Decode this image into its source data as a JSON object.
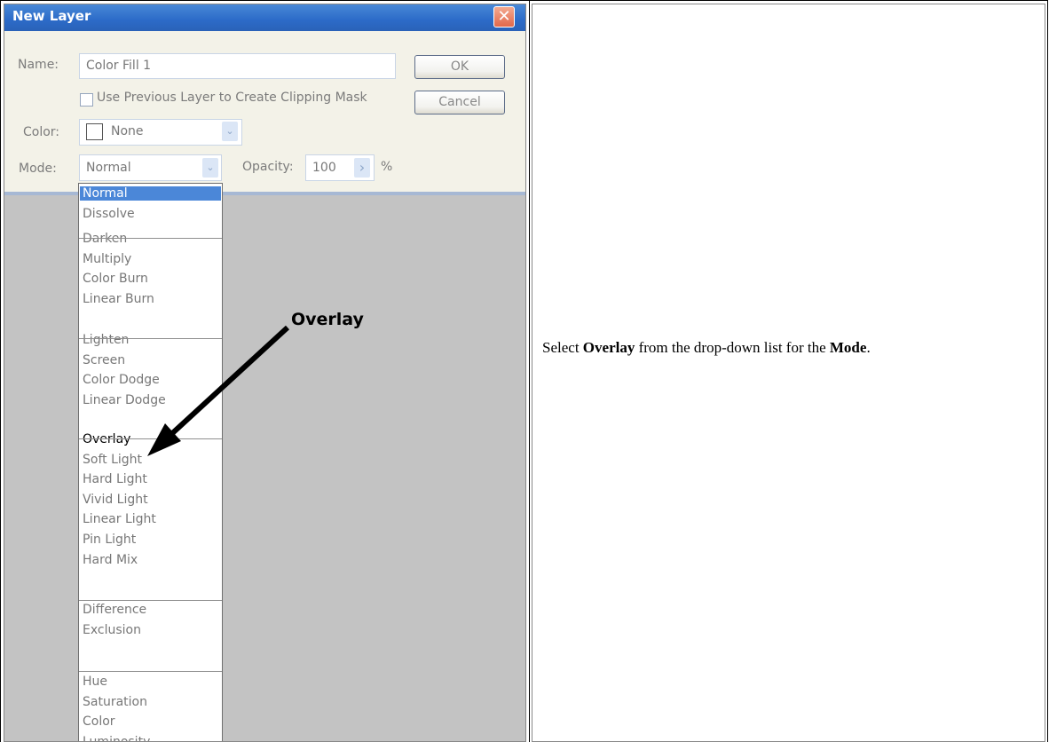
{
  "dialog": {
    "title": "New Layer",
    "close_glyph": "✕",
    "name_label": "Name:",
    "name_value": "Color Fill 1",
    "clip_label": "Use Previous Layer to Create Clipping Mask",
    "color_label": "Color:",
    "color_value": "None",
    "mode_label": "Mode:",
    "mode_value": "Normal",
    "opacity_label": "Opacity:",
    "opacity_value": "100",
    "opacity_unit": "%",
    "ok_label": "OK",
    "cancel_label": "Cancel",
    "arrow_glyph": "›",
    "chevron_glyph": "⌄"
  },
  "mode_list": {
    "groups": [
      [
        "Normal",
        "Dissolve"
      ],
      [
        "Darken",
        "Multiply",
        "Color Burn",
        "Linear Burn"
      ],
      [
        "Lighten",
        "Screen",
        "Color Dodge",
        "Linear Dodge"
      ],
      [
        "Overlay",
        "Soft Light",
        "Hard Light",
        "Vivid Light",
        "Linear Light",
        "Pin Light",
        "Hard Mix"
      ],
      [
        "Difference",
        "Exclusion"
      ],
      [
        "Hue",
        "Saturation",
        "Color",
        "Luminosity"
      ]
    ],
    "selected": "Normal",
    "highlighted": "Overlay"
  },
  "annotation": {
    "callout": "Overlay"
  },
  "instruction": {
    "pre": "Select ",
    "strong1": "Overlay",
    "mid": " from the drop-down list for the ",
    "strong2": "Mode",
    "post": "."
  },
  "colors": {
    "titlebar": "#2c6bc8",
    "dialog_bg": "#f3f2e8",
    "selection": "#4b87d8",
    "canvas_gray": "#c3c3c3"
  },
  "icons": {
    "close": "close-icon",
    "dropdown": "chevron-down-icon",
    "slider": "chevron-right-icon"
  }
}
